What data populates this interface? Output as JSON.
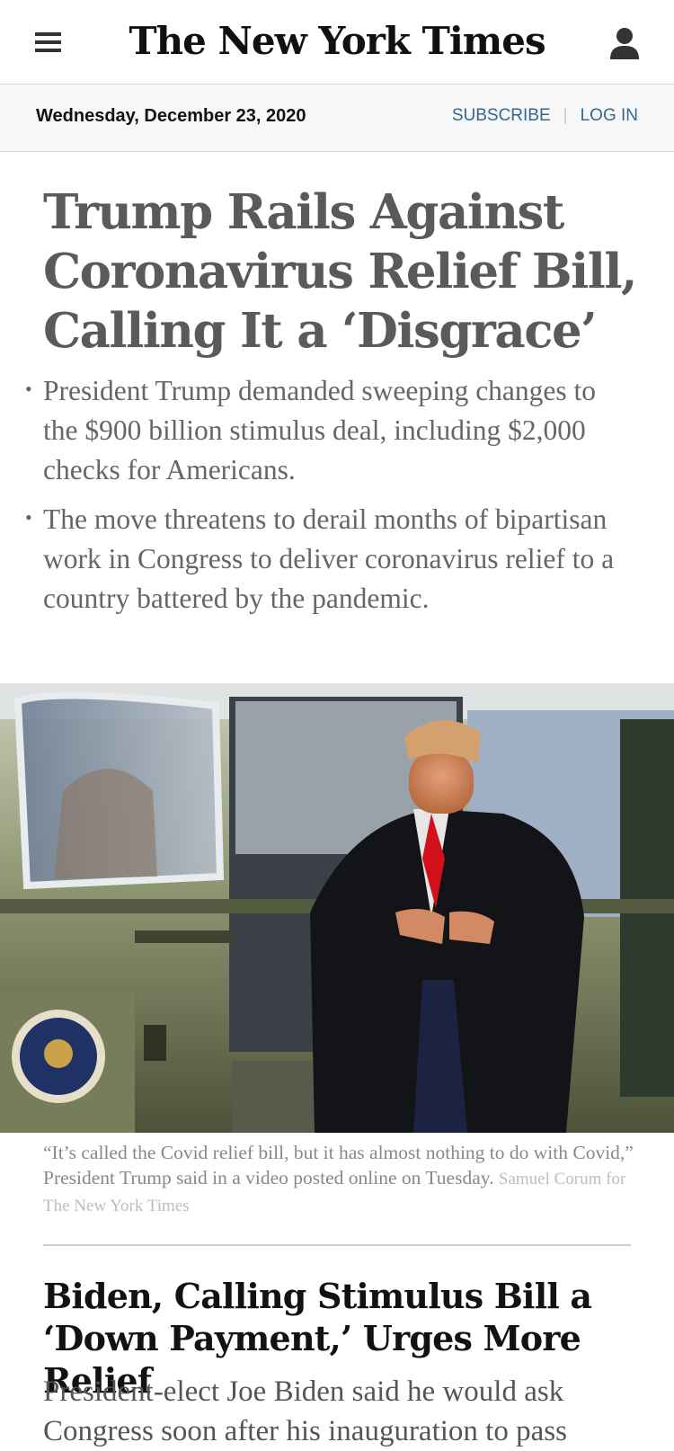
{
  "header": {
    "masthead": "The New York Times",
    "menu_icon": "hamburger-menu-icon",
    "user_icon": "user-account-icon"
  },
  "datebar": {
    "date": "Wednesday, December 23, 2020",
    "subscribe": "SUBSCRIBE",
    "login": "LOG IN"
  },
  "lead_story": {
    "headline": "Trump Rails Against Coronavirus Relief Bill, Calling It a ‘Disgrace’",
    "summary": [
      "President Trump demanded sweeping changes to the $900 billion stimulus deal, including $2,000 checks for Americans.",
      "The move threatens to derail months of bipartisan work in Congress to deliver coronavirus relief to a country battered by the pandemic."
    ],
    "caption": "“It’s called the Covid relief bill, but it has almost nothing to do with Covid,” President Trump said in a video posted online on Tuesday.",
    "credit": "Samuel Corum for The New York Times"
  },
  "second_story": {
    "headline": "Biden, Calling Stimulus Bill a ‘Down Payment,’ Urges More Relief",
    "summary": "President-elect Joe Biden said he would ask Congress soon after his inauguration to pass"
  },
  "colors": {
    "link": "#326891",
    "headline_gray": "#5a5a5a",
    "tie_red": "#d1101c"
  }
}
